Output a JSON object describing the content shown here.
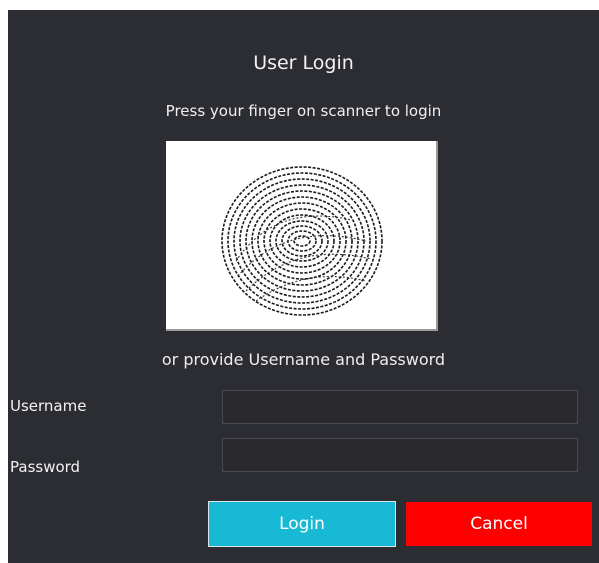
{
  "title": "User Login",
  "instruction": "Press your finger on scanner  to login",
  "scanner": {
    "icon": "fingerprint-icon"
  },
  "alt_text": "or provide Username and Password",
  "username": {
    "label": "Username",
    "value": "",
    "placeholder": ""
  },
  "password": {
    "label": "Password",
    "value": "",
    "placeholder": ""
  },
  "buttons": {
    "login": "Login",
    "cancel": "Cancel"
  },
  "colors": {
    "panel": "#2c2d32",
    "login": "#17b9d4",
    "cancel": "#ff0000"
  }
}
